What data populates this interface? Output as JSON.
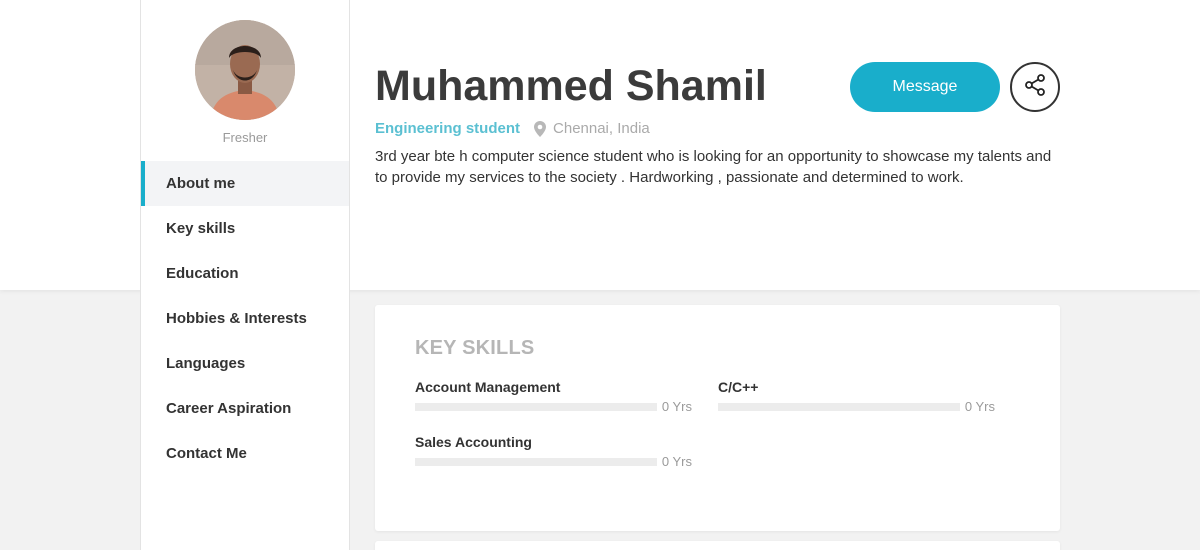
{
  "profile": {
    "name": "Muhammed Shamil",
    "role": "Engineering student",
    "location": "Chennai, India",
    "bio": "3rd year bte h computer science student who is looking for an opportunity to showcase my talents and to provide my services to the society . Hardworking , passionate and determined to work.",
    "level": "Fresher"
  },
  "actions": {
    "message_label": "Message",
    "share_icon": "share-icon"
  },
  "sidebar": {
    "items": [
      {
        "label": "About me",
        "active": true
      },
      {
        "label": "Key skills",
        "active": false
      },
      {
        "label": "Education",
        "active": false
      },
      {
        "label": "Hobbies & Interests",
        "active": false
      },
      {
        "label": "Languages",
        "active": false
      },
      {
        "label": "Career Aspiration",
        "active": false
      },
      {
        "label": "Contact Me",
        "active": false
      }
    ]
  },
  "key_skills": {
    "title": "KEY SKILLS",
    "skills": [
      {
        "name": "Account Management",
        "years": "0 Yrs",
        "level": 0
      },
      {
        "name": "C/C++",
        "years": "0 Yrs",
        "level": 0
      },
      {
        "name": "Sales Accounting",
        "years": "0 Yrs",
        "level": 0
      }
    ]
  },
  "colors": {
    "accent": "#19aecb",
    "role_text": "#5bc0d2",
    "background": "#f2f2f2"
  }
}
